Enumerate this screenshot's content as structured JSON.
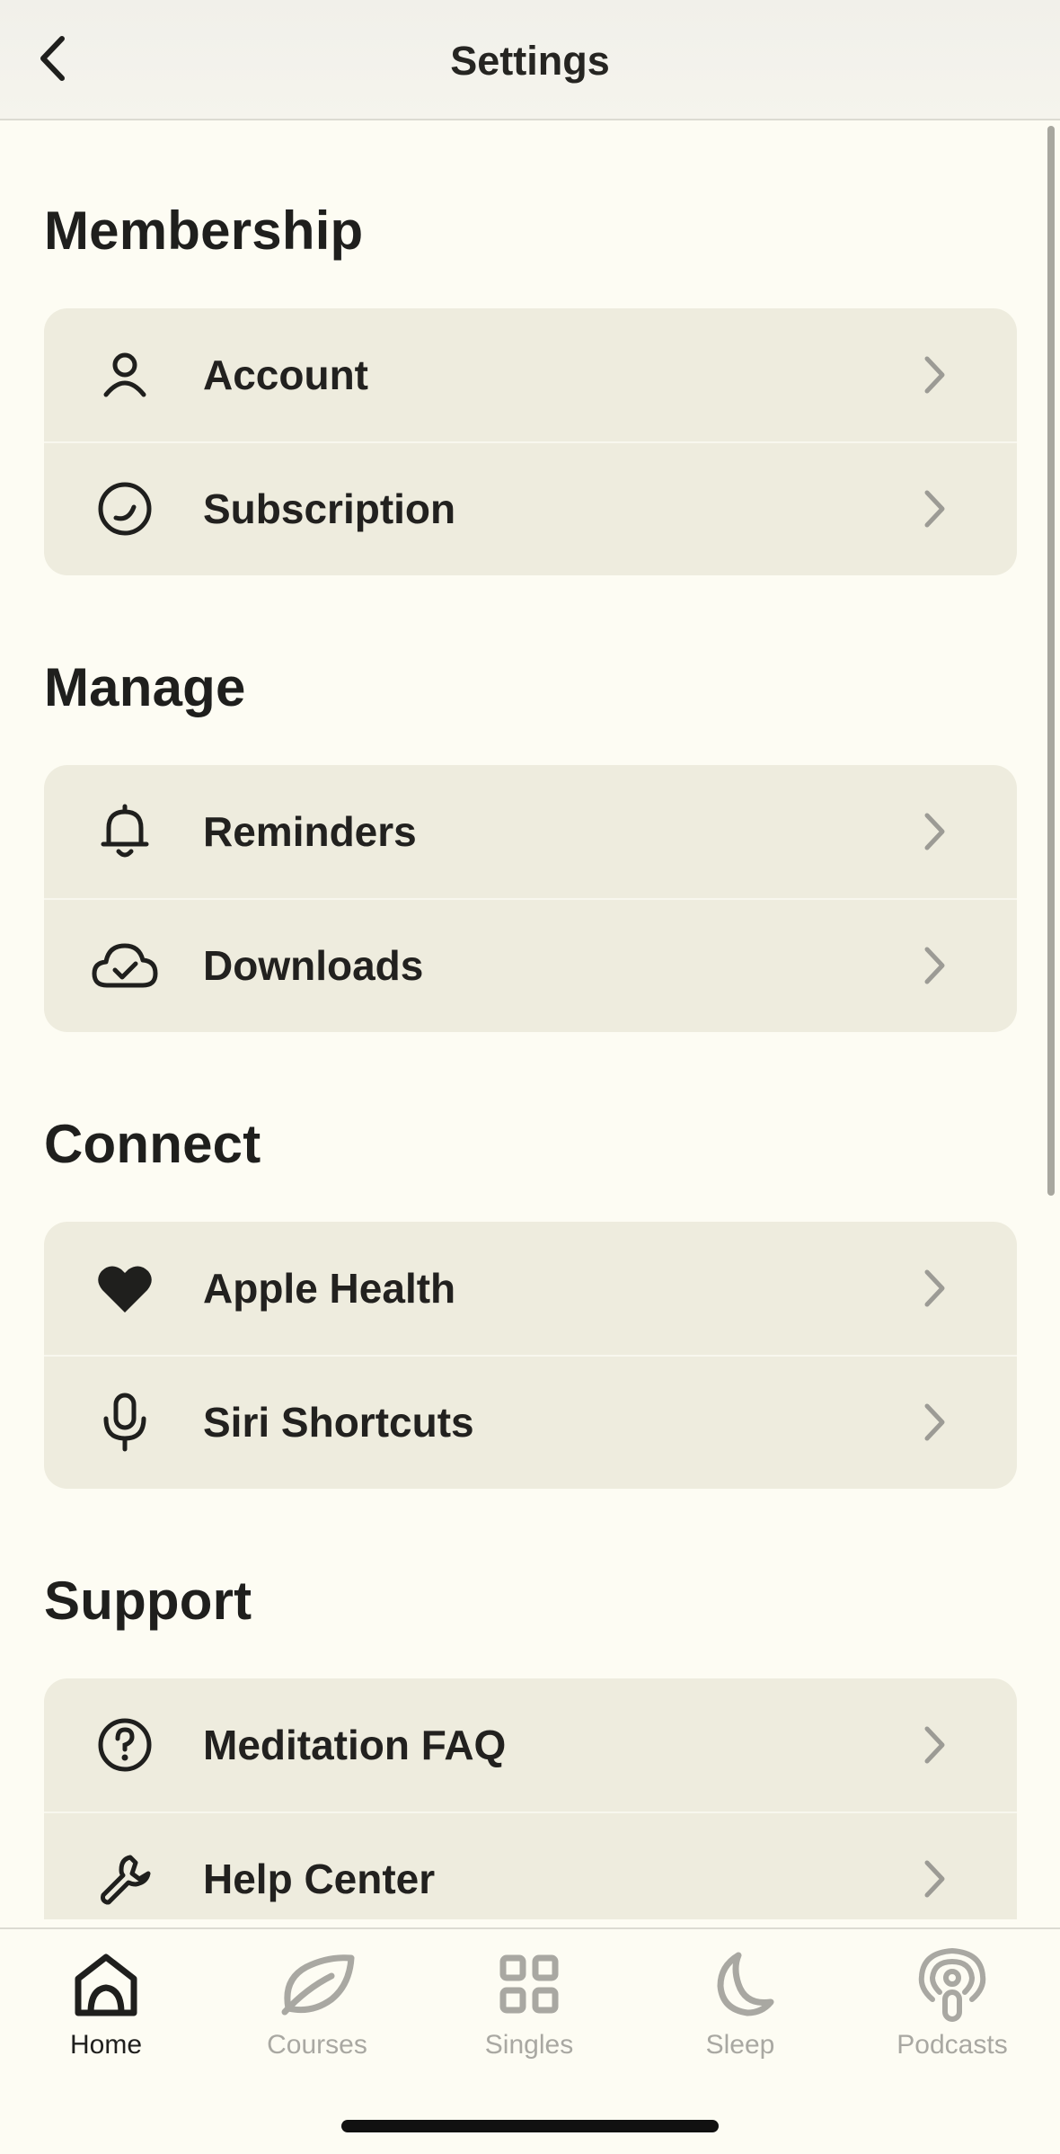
{
  "header": {
    "title": "Settings"
  },
  "sections": [
    {
      "title": "Membership",
      "items": [
        {
          "label": "Account",
          "icon": "person-icon"
        },
        {
          "label": "Subscription",
          "icon": "subscription-icon"
        }
      ]
    },
    {
      "title": "Manage",
      "items": [
        {
          "label": "Reminders",
          "icon": "bell-icon"
        },
        {
          "label": "Downloads",
          "icon": "cloud-check-icon"
        }
      ]
    },
    {
      "title": "Connect",
      "items": [
        {
          "label": "Apple Health",
          "icon": "heart-icon"
        },
        {
          "label": "Siri Shortcuts",
          "icon": "microphone-icon"
        }
      ]
    },
    {
      "title": "Support",
      "items": [
        {
          "label": "Meditation FAQ",
          "icon": "question-icon"
        },
        {
          "label": "Help Center",
          "icon": "wrench-icon"
        }
      ]
    }
  ],
  "tabs": [
    {
      "label": "Home",
      "icon": "home-icon",
      "active": true
    },
    {
      "label": "Courses",
      "icon": "leaf-icon",
      "active": false
    },
    {
      "label": "Singles",
      "icon": "grid-icon",
      "active": false
    },
    {
      "label": "Sleep",
      "icon": "moon-icon",
      "active": false
    },
    {
      "label": "Podcasts",
      "icon": "podcast-icon",
      "active": false
    }
  ],
  "colors": {
    "background": "#fdfcf3",
    "card": "#eeecde",
    "text": "#1f1f1d",
    "inactive": "#a9a8a2"
  }
}
